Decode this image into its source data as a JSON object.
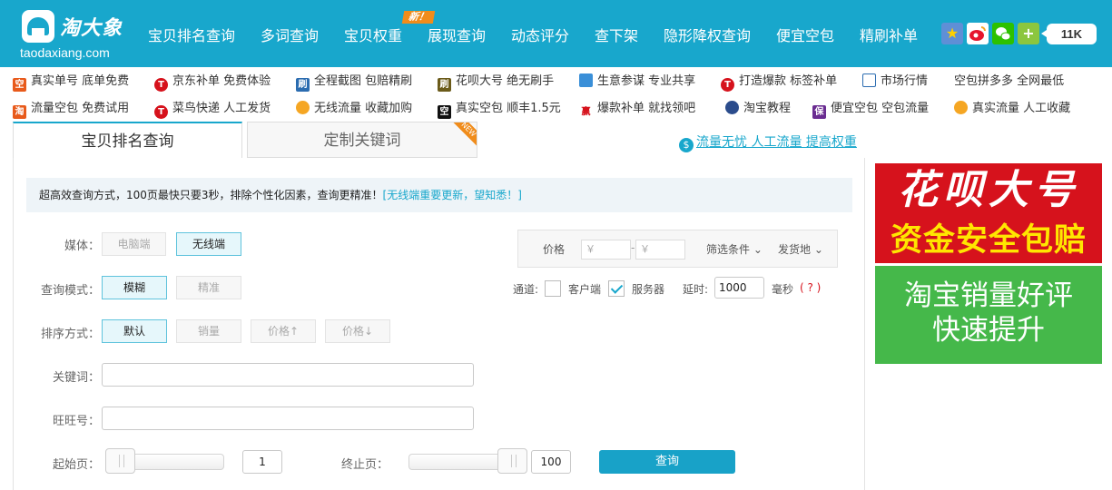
{
  "logo": {
    "brand": "淘大象",
    "domain": "taodaxiang.com"
  },
  "nav": {
    "items": [
      "宝贝排名查询",
      "多词查询",
      "宝贝权重",
      "展现查询",
      "动态评分",
      "查下架",
      "隐形降权查询",
      "便宜空包",
      "精刷补单"
    ],
    "new_badge": "新！",
    "count_badge": "11K"
  },
  "promos": {
    "row1": [
      "真实单号 底单免费",
      "京东补单 免费体验",
      "全程截图 包赔精刷",
      "花呗大号 绝无刷手",
      "生意参谋 专业共享",
      "打造爆款 标签补单",
      "市场行情",
      "空包拼多多 全网最低"
    ],
    "row2": [
      "流量空包 免费试用",
      "菜鸟快递 人工发货",
      "无线流量 收藏加购",
      "真实空包 顺丰1.5元",
      "爆款补单 就找领吧",
      "淘宝教程",
      "便宜空包 空包流量",
      "真实流量 人工收藏"
    ],
    "icon_text": [
      "空",
      "T",
      "刷",
      "刷",
      "",
      "T",
      "",
      "",
      "淘",
      "T",
      "",
      "空",
      "赢",
      "",
      "保",
      ""
    ]
  },
  "tabs": {
    "rank_query": "宝贝排名查询",
    "custom_keyword": "定制关键词",
    "new_corner": "NEW"
  },
  "top_link": "流量无忧 人工流量 提高权重",
  "notice": {
    "text": "超高效查询方式，100页最快只要3秒，排除个性化因素，查询更精准！",
    "link": "[无线端重要更新，望知悉！]"
  },
  "form": {
    "media_label": "媒体：",
    "media_options": [
      "电脑端",
      "无线端"
    ],
    "media_selected": "无线端",
    "mode_label": "查询模式：",
    "mode_options": [
      "模糊",
      "精准"
    ],
    "mode_selected": "模糊",
    "sort_label": "排序方式：",
    "sort_options": [
      "默认",
      "销量",
      "价格↑",
      "价格↓"
    ],
    "sort_selected": "默认",
    "keyword_label": "关键词：",
    "keyword_value": "",
    "wangwang_label": "旺旺号：",
    "wangwang_value": "",
    "start_label": "起始页：",
    "start_value": "1",
    "end_label": "终止页：",
    "end_value": "100",
    "query_button": "查询"
  },
  "filter": {
    "price_label": "价格",
    "price_min_placeholder": "￥",
    "price_dash": "-",
    "price_max_placeholder": "￥",
    "conditions": "筛选条件",
    "ship_from": "发货地"
  },
  "channel": {
    "label": "通道:",
    "client": "客户端",
    "client_checked": false,
    "server": "服务器",
    "server_checked": true,
    "delay_label": "延时:",
    "delay_value": "1000",
    "unit": "毫秒",
    "help": "( ? )"
  },
  "ads": {
    "ad1_line1": "花呗大号",
    "ad1_line2": "资金安全包赔",
    "ad2_line1": "淘宝销量好评",
    "ad2_line2": "快速提升"
  },
  "colors": {
    "accent": "#18a7cc",
    "new_badge": "#f08c1b",
    "ad_red": "#d6121c",
    "ad_yellow": "#ffe600",
    "ad_green": "#45b84a"
  }
}
